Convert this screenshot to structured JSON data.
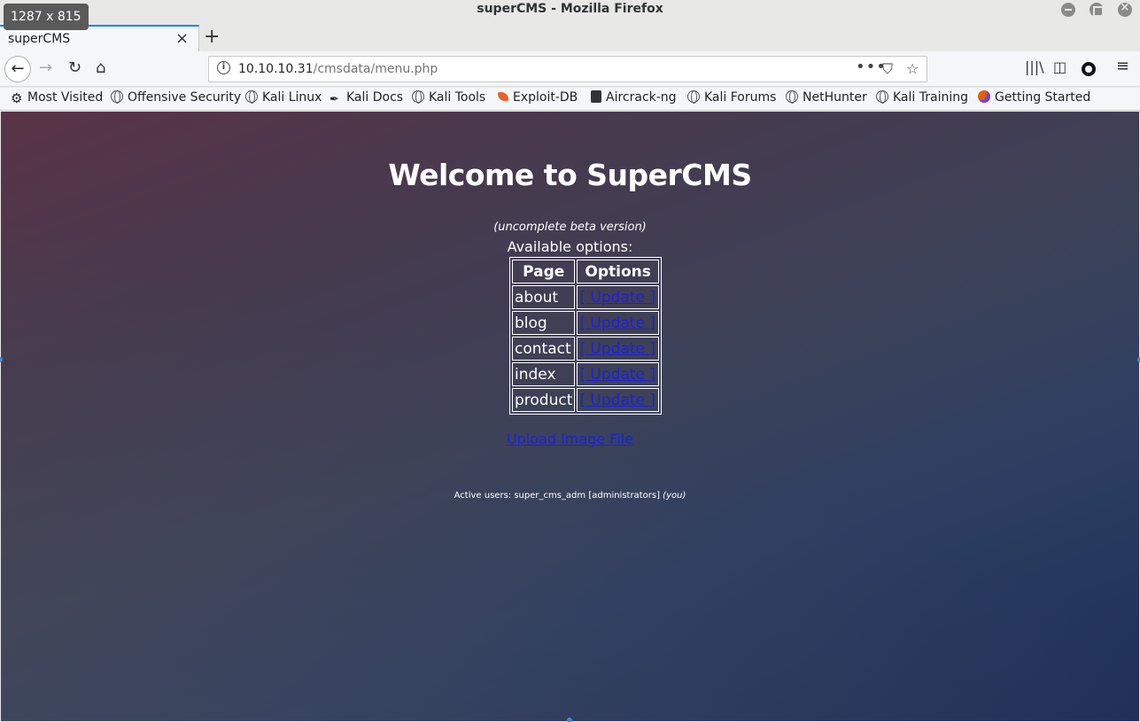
{
  "window": {
    "title": "superCMS - Mozilla Firefox",
    "dimensions_badge": "1287 x 815"
  },
  "tab": {
    "label": "superCMS",
    "close": "×",
    "new_tab": "+"
  },
  "nav": {
    "back": "←",
    "forward": "→",
    "reload": "↻",
    "home": "⌂",
    "url_host": "10.10.10.31",
    "url_path": "/cmsdata/menu.php",
    "page_actions": "•••",
    "bookmark_star": "☆",
    "library_icon": "|||\\",
    "menu": "≡"
  },
  "bookmarks": [
    {
      "label": "Most Visited",
      "icon": "gear-icon"
    },
    {
      "label": "Offensive Security",
      "icon": "globe-icon"
    },
    {
      "label": "Kali Linux",
      "icon": "globe-icon"
    },
    {
      "label": "Kali Docs",
      "icon": "dragon-icon"
    },
    {
      "label": "Kali Tools",
      "icon": "globe-icon"
    },
    {
      "label": "Exploit-DB",
      "icon": "exploitdb-icon"
    },
    {
      "label": "Aircrack-ng",
      "icon": "aircrack-icon"
    },
    {
      "label": "Kali Forums",
      "icon": "globe-icon"
    },
    {
      "label": "NetHunter",
      "icon": "globe-icon"
    },
    {
      "label": "Kali Training",
      "icon": "globe-icon"
    },
    {
      "label": "Getting Started",
      "icon": "firefox-icon"
    }
  ],
  "page": {
    "heading": "Welcome to SuperCMS",
    "beta_note": "(uncomplete beta version)",
    "available_label": "Available options:",
    "table": {
      "headers": [
        "Page",
        "Options"
      ],
      "rows": [
        {
          "page": "about",
          "action": "[ Update ]"
        },
        {
          "page": "blog",
          "action": "[ Update ]"
        },
        {
          "page": "contact",
          "action": "[ Update ]"
        },
        {
          "page": "index",
          "action": "[ Update ]"
        },
        {
          "page": "product",
          "action": "[ Update ]"
        }
      ]
    },
    "upload_link": "Upload Image File",
    "active_users_prefix": "Active users: super_cms_adm [administrators]",
    "active_users_you": "(you)"
  },
  "colors": {
    "link": "#1d21d6",
    "tab_accent": "#0a84ff"
  }
}
